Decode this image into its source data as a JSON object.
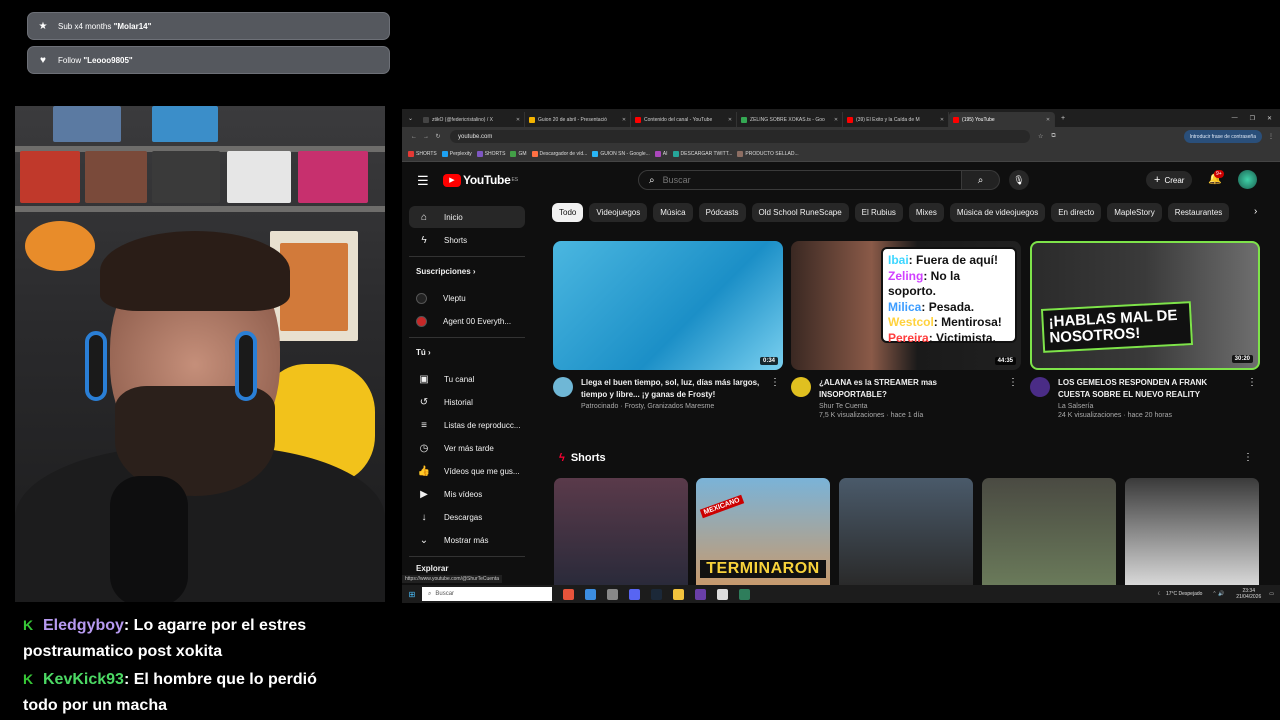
{
  "alerts": [
    {
      "icon": "star-icon",
      "prefix": "Sub x4 months ",
      "name": "\"Molar14\""
    },
    {
      "icon": "heart-icon",
      "prefix": "Follow ",
      "name": "\"Leooo9805\""
    }
  ],
  "chat": [
    {
      "user": "Eledgyboy",
      "message": ": Lo agarre por el estres",
      "message2": "postraumatico post xokita"
    },
    {
      "user": "KevKick93",
      "message": ": El hombre que lo perdió",
      "message2": "todo por un macha"
    }
  ],
  "browser": {
    "tabs": [
      {
        "label": "ztikO (@federicristalino) / X",
        "color": "#444444",
        "active": false
      },
      {
        "label": "Guion 20 de abril - Presentació",
        "color": "#f4b400",
        "active": false
      },
      {
        "label": "Contenido del canal - YouTube",
        "color": "#ff0000",
        "active": false
      },
      {
        "label": "ZELING SOBRE XOKAS.ts - Goo",
        "color": "#34a853",
        "active": false
      },
      {
        "label": "(39) El Éxito y la Caída de M",
        "color": "#ff0000",
        "active": false
      },
      {
        "label": "(195) YouTube",
        "color": "#ff0000",
        "active": true
      }
    ],
    "url": "youtube.com",
    "password_button": "Introducir frase de contraseña",
    "bookmarks": [
      "SHORTS",
      "Perplexity",
      "SHORTS",
      "GM",
      "Descargador de víd...",
      "GUION SN - Google...",
      "AI",
      "DESCARGAR TWITT...",
      "PRODUCTO SELLAD..."
    ]
  },
  "youtube": {
    "logo": "YouTube",
    "region": "ES",
    "search_placeholder": "Buscar",
    "create_label": "Crear",
    "notifications": "9+",
    "sidebar": {
      "main": [
        {
          "label": "Inicio",
          "icon": "home-icon",
          "glyph": "⌂"
        },
        {
          "label": "Shorts",
          "icon": "shorts-icon",
          "glyph": "ϟ"
        }
      ],
      "subs_heading": "Suscripciones",
      "subs": [
        {
          "label": "Vleptu",
          "color": "#222222"
        },
        {
          "label": "Agent 00 Everyth...",
          "color": "#c62828"
        }
      ],
      "you_heading": "Tú",
      "you": [
        {
          "label": "Tu canal",
          "icon": "channel-icon",
          "glyph": "▣"
        },
        {
          "label": "Historial",
          "icon": "history-icon",
          "glyph": "↺"
        },
        {
          "label": "Listas de reproducc...",
          "icon": "playlist-icon",
          "glyph": "≡"
        },
        {
          "label": "Ver más tarde",
          "icon": "clock-icon",
          "glyph": "◷"
        },
        {
          "label": "Vídeos que me gus...",
          "icon": "like-icon",
          "glyph": "👍"
        },
        {
          "label": "Mis vídeos",
          "icon": "my-videos-icon",
          "glyph": "▶"
        },
        {
          "label": "Descargas",
          "icon": "download-icon",
          "glyph": "↓"
        },
        {
          "label": "Mostrar más",
          "icon": "chevron-down-icon",
          "glyph": "⌄"
        }
      ],
      "explore_heading": "Explorar"
    },
    "chips": [
      "Todo",
      "Videojuegos",
      "Música",
      "Pódcasts",
      "Old School RuneScape",
      "El Rubius",
      "Mixes",
      "Música de videojuegos",
      "En directo",
      "MapleStory",
      "Restaurantes"
    ],
    "videos": [
      {
        "title": "Llega el buen tiempo, sol, luz, días más largos, tiempo y libre... ¡y ganas de Frosty!",
        "channel": "Patrocinado · Frosty, Granizados Maresme",
        "stats": "",
        "duration": "0:34",
        "thumb_bg": "linear-gradient(135deg,#4bb7e0,#1b8fc7 60%,#7ad0ef)",
        "avatar_color": "#6fb7d6"
      },
      {
        "title": "¿ALANA es la STREAMER mas INSOPORTABLE?",
        "channel": "Shur Te Cuenta",
        "stats": "7,5 K visualizaciones · hace 1 día",
        "duration": "44:35",
        "thumb_bg": "linear-gradient(90deg,#3a2822,#8a5a48 35%,#1a1a1a 55%,#202020)",
        "avatar_color": "#e0c020",
        "overlay_lines": [
          {
            "name": "Ibai",
            "text": ": Fuera de aquí!",
            "color": "#3dd6ff"
          },
          {
            "name": "Zeling",
            "text": ": No la soporto.",
            "color": "#d040ff"
          },
          {
            "name": "Milica",
            "text": ": Pesada.",
            "color": "#3d9dff"
          },
          {
            "name": "Westcol",
            "text": ": Mentirosa!",
            "color": "#ffd23d"
          },
          {
            "name": "Pereira",
            "text": ": Victimista.",
            "color": "#ff3d3d"
          }
        ]
      },
      {
        "title": "LOS GEMELOS RESPONDEN A FRANK CUESTA SOBRE EL NUEVO REALITY",
        "channel": "La Salsería",
        "stats": "24 K visualizaciones · hace 20 horas",
        "duration": "30:20",
        "thumb_bg": "linear-gradient(90deg,#2b2b2b,#3a3a3a 50%,#6e6e6e)",
        "avatar_color": "#4a2c86",
        "overlay_text": "¡HABLAS MAL DE NOSOTROS!"
      }
    ],
    "shorts_heading": "Shorts",
    "shorts": [
      {
        "bg": "linear-gradient(180deg,#5a3a4a,#2a2a3a)",
        "text": ""
      },
      {
        "bg": "linear-gradient(180deg,#7ab3d8,#c79a6e)",
        "text": "TERMINARON",
        "tag": "MEXICANO"
      },
      {
        "bg": "linear-gradient(180deg,#4a5a6a,#2a2a2a)",
        "text": ""
      },
      {
        "bg": "linear-gradient(180deg,#4a4a42,#6a7a5a)",
        "text": ""
      },
      {
        "bg": "linear-gradient(180deg,#3a3a3a,#d8d8d8)",
        "text": ""
      }
    ],
    "status_url": "https://www.youtube.com/@ShurTeCuenta"
  },
  "taskbar": {
    "search_placeholder": "Buscar",
    "weather": "17°C  Despejado",
    "time": "23:34",
    "date": "21/04/2026"
  }
}
